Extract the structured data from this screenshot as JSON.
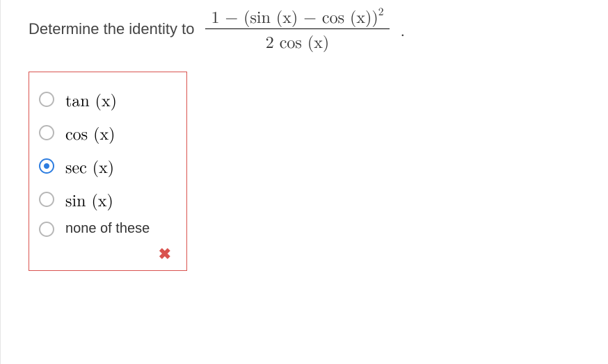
{
  "prompt": "Determine the identity to",
  "expression": {
    "numerator": "1 − (sin (x) − cos (x))",
    "numerator_exp": "2",
    "denominator": "2 cos (x)"
  },
  "period": ".",
  "options": [
    {
      "label": "tan (x)",
      "selected": false,
      "math": true
    },
    {
      "label": "cos (x)",
      "selected": false,
      "math": true
    },
    {
      "label": "sec (x)",
      "selected": true,
      "math": true
    },
    {
      "label": "sin (x)",
      "selected": false,
      "math": true
    },
    {
      "label": "none of these",
      "selected": false,
      "math": false
    }
  ],
  "feedback_icon": "✖"
}
